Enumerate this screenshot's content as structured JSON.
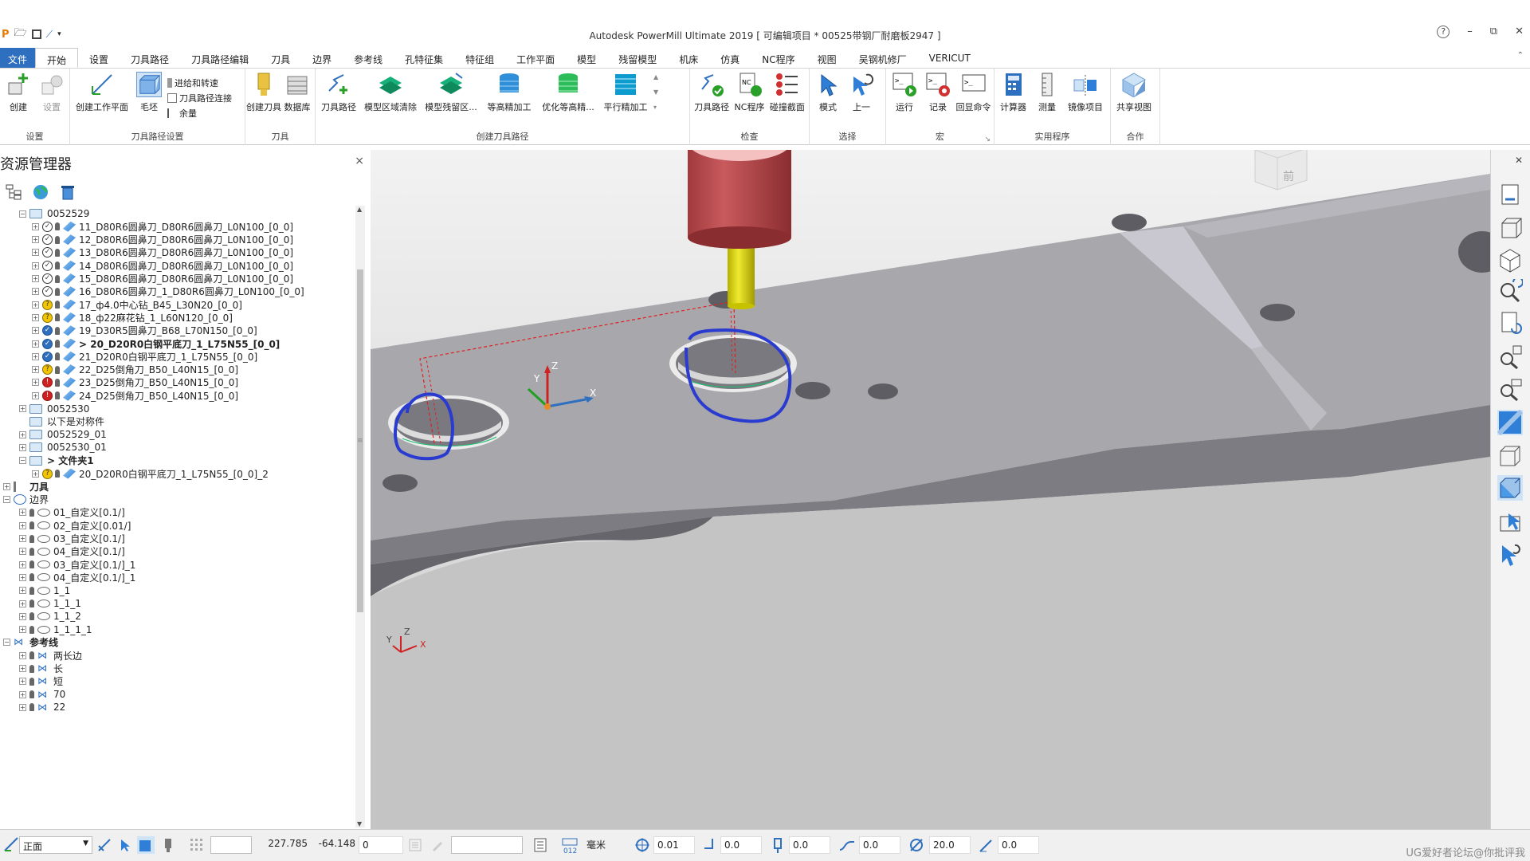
{
  "window": {
    "title": "Autodesk PowerMill Ultimate 2019   [ 可编辑项目 * 00525带钢厂耐磨板2947 ]",
    "help": "?",
    "minimize": "–",
    "restore": "⧉",
    "close": "✕"
  },
  "menu": {
    "tabs": [
      "文件",
      "开始",
      "设置",
      "刀具路径",
      "刀具路径编辑",
      "刀具",
      "边界",
      "参考线",
      "孔特征集",
      "特征组",
      "工作平面",
      "模型",
      "残留模型",
      "机床",
      "仿真",
      "NC程序",
      "视图",
      "吴钢机修厂",
      "VERICUT"
    ],
    "active": "开始"
  },
  "ribbon": {
    "groups": [
      {
        "label": "设置",
        "buttons": [
          "创建",
          "设置"
        ]
      },
      {
        "label": "刀具路径设置",
        "buttons": [
          "创建工作平面",
          "毛坯"
        ],
        "small": [
          "进给和转速",
          "刀具路径连接",
          "余量"
        ]
      },
      {
        "label": "刀具",
        "buttons": [
          "创建刀具",
          "数据库"
        ]
      },
      {
        "label": "创建刀具路径",
        "buttons": [
          "刀具路径",
          "模型区域清除",
          "模型残留区...",
          "等高精加工",
          "优化等高精...",
          "平行精加工"
        ]
      },
      {
        "label": "检查",
        "buttons": [
          "刀具路径",
          "NC程序",
          "碰撞截面"
        ]
      },
      {
        "label": "选择",
        "buttons": [
          "模式",
          "上一"
        ]
      },
      {
        "label": "宏",
        "buttons": [
          "运行",
          "记录",
          "回显命令"
        ]
      },
      {
        "label": "实用程序",
        "buttons": [
          "计算器",
          "测量",
          "镜像项目"
        ]
      },
      {
        "label": "合作",
        "buttons": [
          "共享视图"
        ]
      }
    ]
  },
  "explorer": {
    "title": "资源管理器",
    "close": "×",
    "tree": [
      {
        "text": "0052529",
        "level": 1,
        "type": "folder"
      },
      {
        "text": "11_D80R6圆鼻刀_D80R6圆鼻刀_L0N100_[0_0]",
        "level": 2,
        "status": "ok"
      },
      {
        "text": "12_D80R6圆鼻刀_D80R6圆鼻刀_L0N100_[0_0]",
        "level": 2,
        "status": "ok"
      },
      {
        "text": "13_D80R6圆鼻刀_D80R6圆鼻刀_L0N100_[0_0]",
        "level": 2,
        "status": "ok"
      },
      {
        "text": "14_D80R6圆鼻刀_D80R6圆鼻刀_L0N100_[0_0]",
        "level": 2,
        "status": "ok"
      },
      {
        "text": "15_D80R6圆鼻刀_D80R6圆鼻刀_L0N100_[0_0]",
        "level": 2,
        "status": "ok"
      },
      {
        "text": "16_D80R6圆鼻刀_1_D80R6圆鼻刀_L0N100_[0_0]",
        "level": 2,
        "status": "ok"
      },
      {
        "text": "17_ф4.0中心钻_B45_L30N20_[0_0]",
        "level": 2,
        "status": "warn"
      },
      {
        "text": "18_ф22麻花钻_1_L60N120_[0_0]",
        "level": 2,
        "status": "warn"
      },
      {
        "text": "19_D30R5圆鼻刀_B68_L70N150_[0_0]",
        "level": 2,
        "status": "blue"
      },
      {
        "text": "> 20_D20R0白钢平底刀_1_L75N55_[0_0]",
        "level": 2,
        "status": "blue",
        "bold": true
      },
      {
        "text": "21_D20R0白钢平底刀_1_L75N55_[0_0]",
        "level": 2,
        "status": "blue"
      },
      {
        "text": "22_D25倒角刀_B50_L40N15_[0_0]",
        "level": 2,
        "status": "warn"
      },
      {
        "text": "23_D25倒角刀_B50_L40N15_[0_0]",
        "level": 2,
        "status": "err"
      },
      {
        "text": "24_D25倒角刀_B50_L40N15_[0_0]",
        "level": 2,
        "status": "err"
      },
      {
        "text": "0052530",
        "level": 1,
        "type": "folder"
      },
      {
        "text": "以下是对称件",
        "level": 1,
        "type": "folder",
        "noexp": true
      },
      {
        "text": "0052529_01",
        "level": 1,
        "type": "folder"
      },
      {
        "text": "0052530_01",
        "level": 1,
        "type": "folder"
      },
      {
        "text": "> 文件夹1",
        "level": 1,
        "type": "folder",
        "bold": true
      },
      {
        "text": "20_D20R0白钢平底刀_1_L75N55_[0_0]_2",
        "level": 2,
        "status": "warn"
      },
      {
        "text": "刀具",
        "level": 0,
        "type": "tool",
        "bold": true
      },
      {
        "text": "边界",
        "level": 0,
        "type": "boundary"
      },
      {
        "text": "01_自定义[0.1/]",
        "level": 1,
        "type": "bnd"
      },
      {
        "text": "02_自定义[0.01/]",
        "level": 1,
        "type": "bnd"
      },
      {
        "text": "03_自定义[0.1/]",
        "level": 1,
        "type": "bnd"
      },
      {
        "text": "04_自定义[0.1/]",
        "level": 1,
        "type": "bnd"
      },
      {
        "text": "03_自定义[0.1/]_1",
        "level": 1,
        "type": "bnd"
      },
      {
        "text": "04_自定义[0.1/]_1",
        "level": 1,
        "type": "bnd"
      },
      {
        "text": "1_1",
        "level": 1,
        "type": "bnd"
      },
      {
        "text": "1_1_1",
        "level": 1,
        "type": "bnd"
      },
      {
        "text": "1_1_2",
        "level": 1,
        "type": "bnd"
      },
      {
        "text": "1_1_1_1",
        "level": 1,
        "type": "bnd"
      },
      {
        "text": "参考线",
        "level": 0,
        "type": "pattern",
        "bold": true
      },
      {
        "text": "两长边",
        "level": 1,
        "type": "pat"
      },
      {
        "text": "长",
        "level": 1,
        "type": "pat"
      },
      {
        "text": "短",
        "level": 1,
        "type": "pat"
      },
      {
        "text": "70",
        "level": 1,
        "type": "pat"
      },
      {
        "text": "22",
        "level": 1,
        "type": "pat"
      }
    ]
  },
  "viewport": {
    "viewcube_label": "前",
    "axis": {
      "x": "X",
      "y": "Y",
      "z": "Z"
    },
    "colors": {
      "tool_holder": "#b8474a",
      "tool_shank": "#d8d400",
      "markup": "#2a3bd0",
      "toolpath": "#e02020"
    }
  },
  "statusbar": {
    "view": "正面",
    "coord_x": "227.785",
    "coord_y": "-64.148",
    "coord_z": "0",
    "units": "毫米",
    "tolerance": "0.01",
    "thickness": "0.0",
    "tool_val": "0.0",
    "lead_val": "0.0",
    "diameter": "20.0",
    "angle": "0.0",
    "watermark": "UG爱好者论坛@你批评我"
  }
}
